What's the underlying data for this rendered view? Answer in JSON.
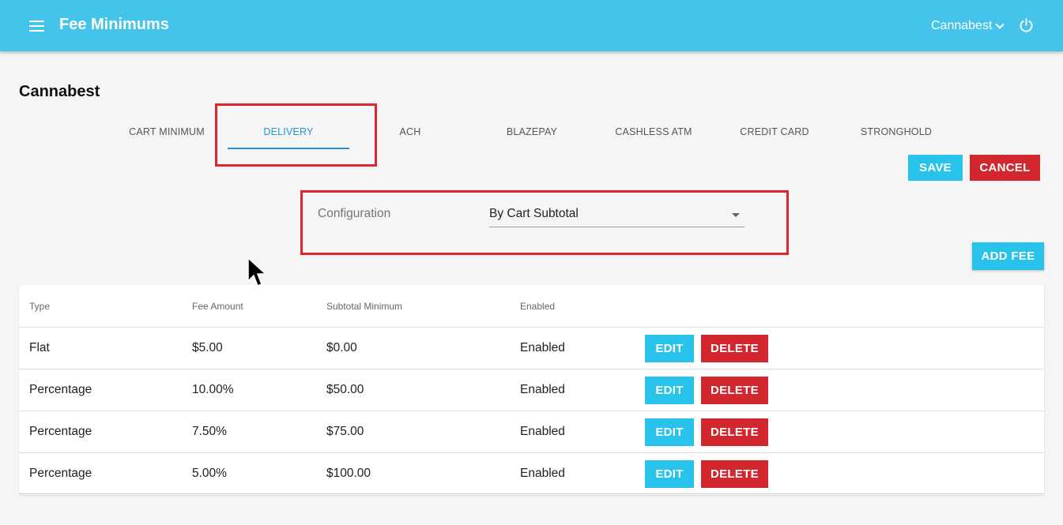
{
  "header": {
    "title": "Fee Minimums",
    "account": "Cannabest"
  },
  "store_title": "Cannabest",
  "tabs": [
    {
      "label": "CART MINIMUM",
      "active": false
    },
    {
      "label": "DELIVERY",
      "active": true
    },
    {
      "label": "ACH",
      "active": false
    },
    {
      "label": "BLAZEPAY",
      "active": false
    },
    {
      "label": "CASHLESS ATM",
      "active": false
    },
    {
      "label": "CREDIT CARD",
      "active": false
    },
    {
      "label": "STRONGHOLD",
      "active": false
    }
  ],
  "actions": {
    "save": "SAVE",
    "cancel": "CANCEL",
    "add_fee": "ADD FEE"
  },
  "configuration": {
    "label": "Configuration",
    "value": "By Cart Subtotal"
  },
  "table": {
    "headers": [
      "Type",
      "Fee Amount",
      "Subtotal Minimum",
      "Enabled"
    ],
    "edit_label": "EDIT",
    "delete_label": "DELETE",
    "rows": [
      {
        "type": "Flat",
        "fee_amount": "$5.00",
        "subtotal_minimum": "$0.00",
        "enabled": "Enabled"
      },
      {
        "type": "Percentage",
        "fee_amount": "10.00%",
        "subtotal_minimum": "$50.00",
        "enabled": "Enabled"
      },
      {
        "type": "Percentage",
        "fee_amount": "7.50%",
        "subtotal_minimum": "$75.00",
        "enabled": "Enabled"
      },
      {
        "type": "Percentage",
        "fee_amount": "5.00%",
        "subtotal_minimum": "$100.00",
        "enabled": "Enabled"
      }
    ]
  },
  "colors": {
    "header_bg": "#44c4ea",
    "primary_button": "#27c3ea",
    "danger_button": "#d3272f",
    "active_tab": "#2196d3",
    "highlight_box": "#e0242d"
  }
}
